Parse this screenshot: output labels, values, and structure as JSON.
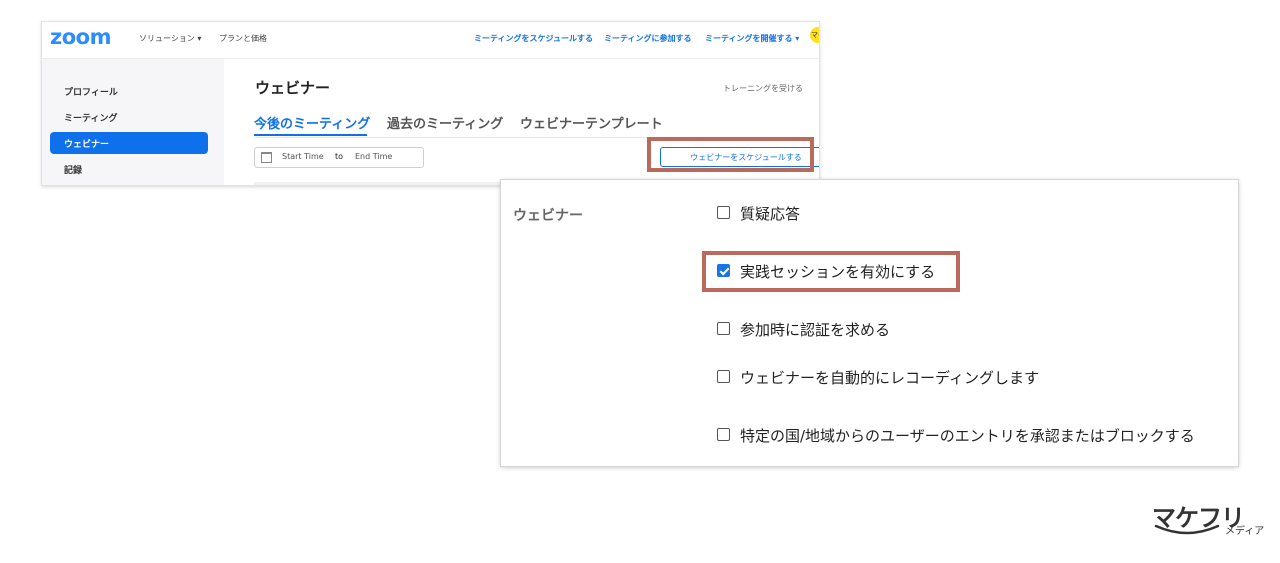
{
  "zoom": {
    "logo": "zoom",
    "header": {
      "solutions": "ソリューション ▾",
      "pricing": "プランと価格",
      "schedule_meeting": "ミーティングをスケジュールする",
      "join_meeting": "ミーティングに参加する",
      "host_meeting": "ミーティングを開催する ▾",
      "avatar_text": "マケ"
    },
    "sidebar": {
      "items": [
        "プロフィール",
        "ミーティング",
        "ウェビナー",
        "記録"
      ],
      "active": "ウェビナー"
    },
    "page_title": "ウェビナー",
    "training_link": "トレーニングを受ける",
    "tabs": [
      "今後のミーティング",
      "過去のミーティング",
      "ウェビナーテンプレート"
    ],
    "active_tab": "今後のミーティング",
    "date_range": {
      "start": "Start Time",
      "separator": "to",
      "end": "End Time"
    },
    "schedule_webinar_button": "ウェビナーをスケジュールする"
  },
  "settings": {
    "section_label": "ウェビナー",
    "options": [
      {
        "label": "質疑応答",
        "checked": false
      },
      {
        "label": "実践セッションを有効にする",
        "checked": true
      },
      {
        "label": "参加時に認証を求める",
        "checked": false
      },
      {
        "label": "ウェビナーを自動的にレコーディングします",
        "checked": false
      },
      {
        "label": "特定の国/地域からのユーザーのエントリを承認またはブロックする",
        "checked": false
      }
    ]
  },
  "brand": {
    "name": "マケフリ",
    "suffix": "メディア"
  },
  "colors": {
    "zoom_blue": "#2D8CFF",
    "link_blue": "#0E71EB",
    "highlight": "#B96A5A",
    "checkbox_blue": "#1A73E8"
  }
}
